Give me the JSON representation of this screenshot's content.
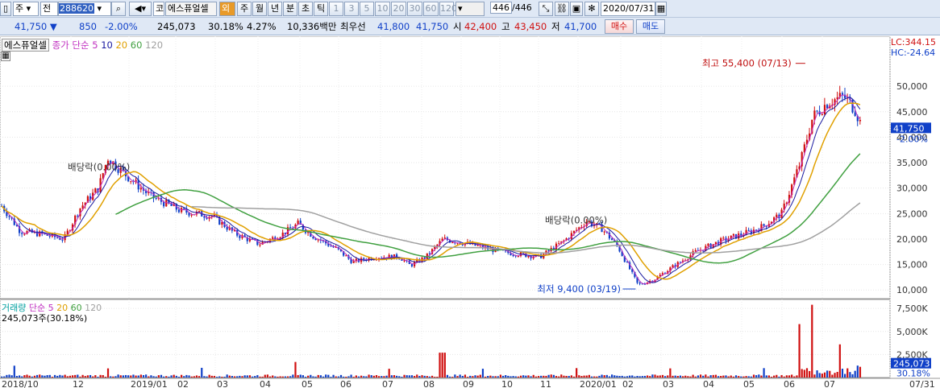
{
  "toolbar": {
    "left_icon": "chart-icon",
    "period_unit": "주",
    "market": "전",
    "code": "288620",
    "search_icon": "search-icon",
    "speaker_icon": "speaker-icon",
    "market_short": "코",
    "stock_name": "에스퓨얼셀",
    "tag": "외",
    "periods": [
      "주",
      "월",
      "년",
      "분",
      "초",
      "틱"
    ],
    "intervals": [
      "1",
      "3",
      "5",
      "10",
      "20",
      "30",
      "60",
      "120"
    ],
    "count": "446",
    "total": "/446",
    "date": "2020/07/31",
    "calendar_icon": "calendar-icon"
  },
  "quote": {
    "price": "41,750",
    "direction": "▼",
    "change": "850",
    "change_pct": "-2.00%",
    "volume": "245,073",
    "turnover_pct": "30.18%",
    "pct2": "4.27%",
    "amount": "10,336백만",
    "best_label": "최우선",
    "ask": "41,800",
    "bid": "41,750",
    "open_label": "시",
    "open": "42,400",
    "high_label": "고",
    "high": "43,450",
    "low_label": "저",
    "low": "41,700",
    "buy_button": "매수",
    "sell_button": "매도"
  },
  "price_panel": {
    "legend_name": "에스퓨얼셀",
    "ma_label": "종가 단순",
    "ma_periods": [
      "5",
      "10",
      "20",
      "60",
      "120"
    ],
    "ma_colors": [
      "#c030c0",
      "#1a1aa0",
      "#e0a000",
      "#40a040",
      "#a0a0a0"
    ],
    "lc": "LC:344.15",
    "hc": "HC:-24.64",
    "price_tag": "41,750",
    "pct_tag": "-2.00%",
    "yticks": [
      "50,000",
      "45,000",
      "40,000",
      "35,000",
      "30,000",
      "25,000",
      "20,000",
      "15,000",
      "10,000"
    ],
    "annotations": {
      "high": "최고 55,400 (07/13)",
      "low": "최저 9,400 (03/19)",
      "dividend1": "배당락(0.00%)",
      "dividend2": "배당락(0.00%)"
    }
  },
  "volume_panel": {
    "legend_name": "거래량",
    "ma_label": "단순",
    "ma_periods": [
      "5",
      "20",
      "60",
      "120"
    ],
    "current": "245,073주(30.18%)",
    "yticks": [
      "7,500K",
      "5,000K",
      "2,500K"
    ],
    "value_tag": "245,073",
    "pct_tag": "30.18%"
  },
  "xaxis": [
    "2018/10",
    "12",
    "2019/01",
    "02",
    "03",
    "04",
    "05",
    "06",
    "07",
    "08",
    "09",
    "10",
    "11",
    "2020/01",
    "02",
    "03",
    "04",
    "05",
    "06",
    "07",
    "07/31"
  ]
}
